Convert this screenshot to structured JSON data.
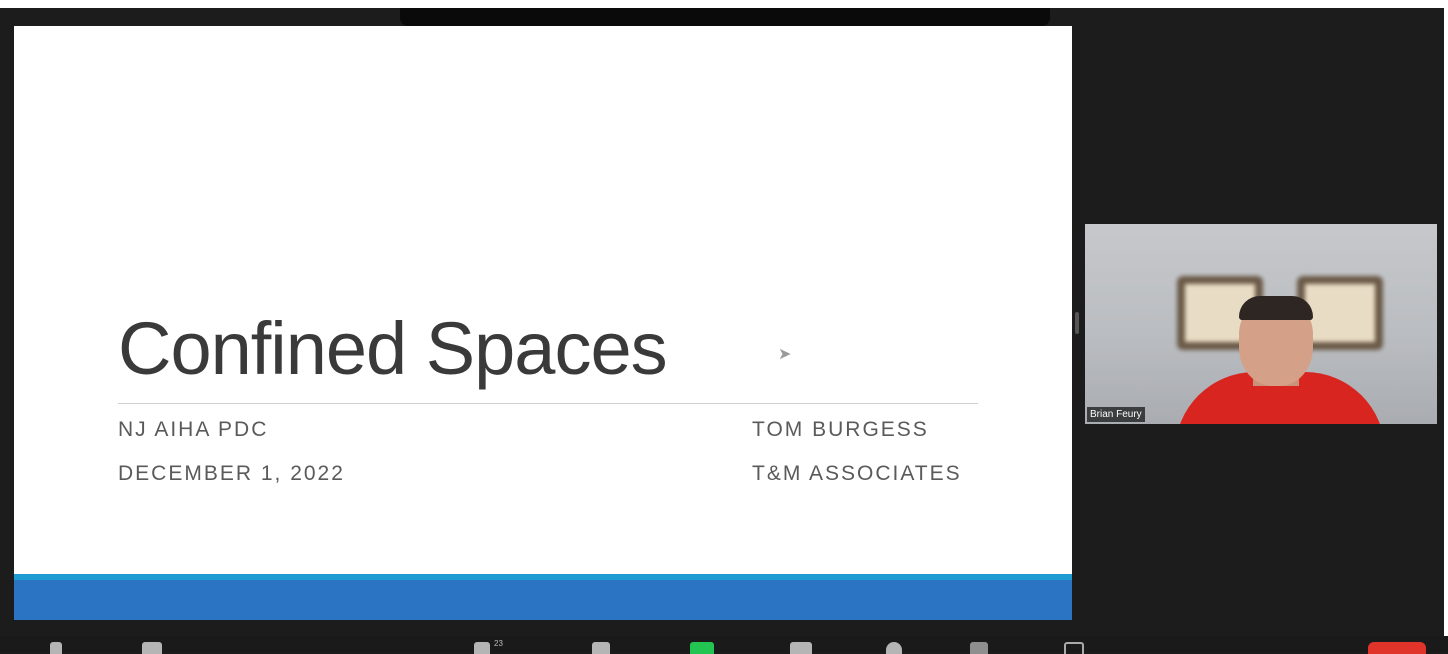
{
  "slide": {
    "title": "Confined Spaces",
    "line1_left": "NJ AIHA PDC",
    "line2_left": "DECEMBER 1, 2022",
    "line1_right": "TOM BURGESS",
    "line2_right": "T&M ASSOCIATES"
  },
  "participant": {
    "name": "Brian Feury"
  },
  "toolbar": {
    "participants_count": "23"
  },
  "colors": {
    "app_background": "#1c1c1c",
    "slide_band_blue": "#2b74c4",
    "slide_band_light": "#1e9bd1",
    "share_green": "#23c552",
    "end_red": "#e0342b",
    "shirt_red": "#d8251f"
  }
}
